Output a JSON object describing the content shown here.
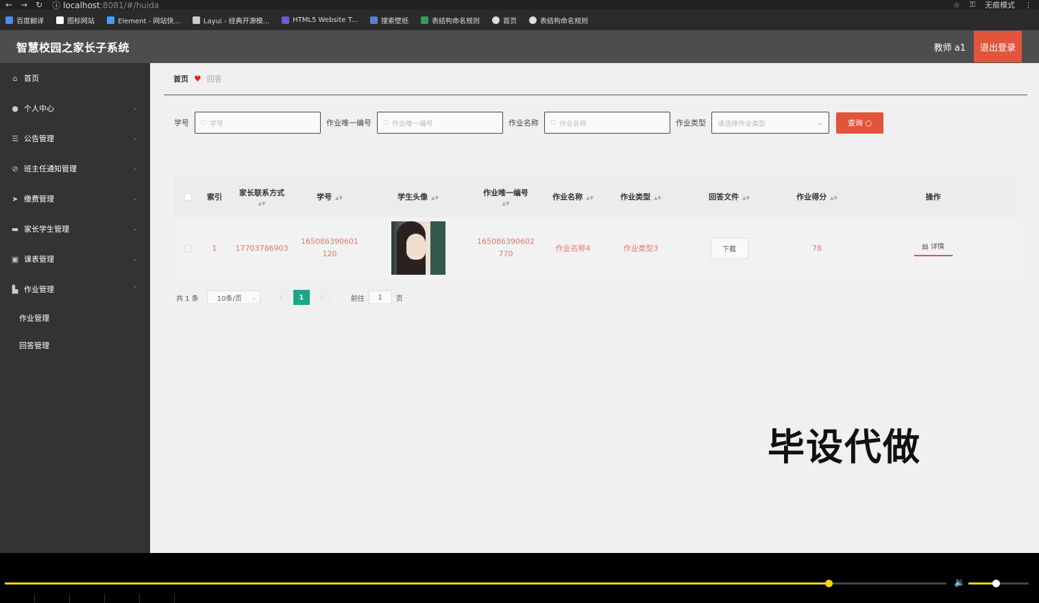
{
  "browser": {
    "url_host": "localhost",
    "url_rest": ":8081/#/huida",
    "incognito_label": "无痕模式",
    "bookmarks": [
      "百度翻译",
      "图标网站",
      "Element - 网站快...",
      "Layui - 经典开源模...",
      "HTML5 Website T...",
      "搜索壁纸",
      "表结构命名规则",
      "首页",
      "表结构命名规则"
    ]
  },
  "header": {
    "title": "智慧校园之家长子系统",
    "user": "教师 a1",
    "logout": "退出登录"
  },
  "sidebar": {
    "items": [
      {
        "label": "首页",
        "icon": "home-icon",
        "glyph": "⌂",
        "arrow": ""
      },
      {
        "label": "个人中心",
        "icon": "user-icon",
        "glyph": "●",
        "arrow": "⌄"
      },
      {
        "label": "公告管理",
        "icon": "list-icon",
        "glyph": "☰",
        "arrow": "⌄"
      },
      {
        "label": "班主任通知管理",
        "icon": "notify-icon",
        "glyph": "⊘",
        "arrow": "⌄"
      },
      {
        "label": "缴费管理",
        "icon": "send-icon",
        "glyph": "➤",
        "arrow": "⌄"
      },
      {
        "label": "家长学生管理",
        "icon": "monitor-icon",
        "glyph": "▬",
        "arrow": "⌄"
      },
      {
        "label": "课表管理",
        "icon": "checklist-icon",
        "glyph": "▣",
        "arrow": "⌄"
      },
      {
        "label": "作业管理",
        "icon": "folder-icon",
        "glyph": "▙",
        "arrow": "⌃"
      }
    ],
    "sub_items": [
      "作业管理",
      "回答管理"
    ]
  },
  "breadcrumb": {
    "home": "首页",
    "current": "回答"
  },
  "search": {
    "fields": [
      {
        "label": "学号",
        "placeholder": "学号",
        "width": 184
      },
      {
        "label": "作业唯一编号",
        "placeholder": "作业唯一编号",
        "width": 184
      },
      {
        "label": "作业名称",
        "placeholder": "作业名称",
        "width": 184
      }
    ],
    "type_label": "作业类型",
    "type_placeholder": "请选择作业类型",
    "query_button": "查询"
  },
  "table": {
    "headers": [
      "索引",
      "家长联系方式",
      "学号",
      "学生头像",
      "作业唯一编号",
      "作业名称",
      "作业类型",
      "回答文件",
      "作业得分",
      "操作"
    ],
    "rows": [
      {
        "index": "1",
        "parent_phone": "17703786903",
        "student_no": "165086390601 120",
        "homework_no": "165086390602 770",
        "homework_name": "作业名称4",
        "homework_type": "作业类型3",
        "file_button": "下载",
        "score": "78",
        "action": "详情"
      }
    ]
  },
  "pager": {
    "total": "共 1 条",
    "page_size": "10条/页",
    "current_page": "1",
    "goto_label": "前往",
    "goto_value": "1",
    "page_suffix": "页"
  },
  "watermark": "毕设代做",
  "player": {
    "progress": 0.875,
    "volume": 0.45
  }
}
